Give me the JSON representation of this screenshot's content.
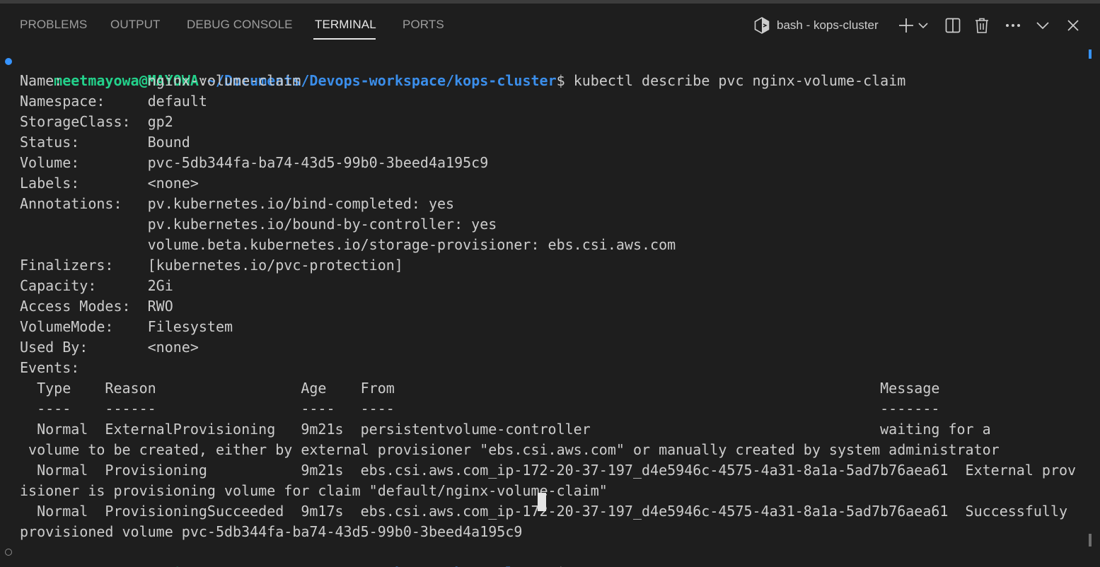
{
  "panel": {
    "tabs": [
      "PROBLEMS",
      "OUTPUT",
      "DEBUG CONSOLE",
      "TERMINAL",
      "PORTS"
    ],
    "active_tab": "TERMINAL",
    "terminal_name": "bash - kops-cluster",
    "icons": [
      "bash-terminal-icon",
      "new-terminal-icon",
      "launch-profile-chevron-icon",
      "split-terminal-icon",
      "kill-terminal-icon",
      "more-actions-icon",
      "maximize-panel-chevron-icon",
      "close-panel-icon"
    ]
  },
  "terminal": {
    "prompt_user": "meetmayowa@MAYOWA",
    "prompt_sep": ":",
    "prompt_path": "~/Documents/Devops-workspace/kops-cluster",
    "prompt_symbol": "$",
    "command": " kubectl describe pvc nginx-volume-claim",
    "output_lines": [
      "Name:          nginx-volume-claim",
      "Namespace:     default",
      "StorageClass:  gp2",
      "Status:        Bound",
      "Volume:        pvc-5db344fa-ba74-43d5-99b0-3beed4a195c9",
      "Labels:        <none>",
      "Annotations:   pv.kubernetes.io/bind-completed: yes",
      "               pv.kubernetes.io/bound-by-controller: yes",
      "               volume.beta.kubernetes.io/storage-provisioner: ebs.csi.aws.com",
      "Finalizers:    [kubernetes.io/pvc-protection]",
      "Capacity:      2Gi",
      "Access Modes:  RWO",
      "VolumeMode:    Filesystem",
      "Used By:       <none>",
      "Events:",
      "  Type    Reason                 Age    From                                                         Message",
      "  ----    ------                 ----   ----                                                         -------",
      "  Normal  ExternalProvisioning   9m21s  persistentvolume-controller                                  waiting for a",
      " volume to be created, either by external provisioner \"ebs.csi.aws.com\" or manually created by system administrator",
      "  Normal  Provisioning           9m21s  ebs.csi.aws.com_ip-172-20-37-197_d4e5946c-4575-4a31-8a1a-5ad7b76aea61  External prov",
      "isioner is provisioning volume for claim \"default/nginx-volume-claim\"",
      "  Normal  ProvisioningSucceeded  9m17s  ebs.csi.aws.com_ip-172-20-37-197_d4e5946c-4575-4a31-8a1a-5ad7b76aea61  Successfully",
      "provisioned volume pvc-5db344fa-ba74-43d5-99b0-3beed4a195c9"
    ]
  },
  "colors": {
    "background": "#1e1e1e",
    "prompt_user": "#23d18b",
    "prompt_path": "#3b8eea",
    "text": "#cccccc",
    "decoration_success": "#3794ff"
  }
}
